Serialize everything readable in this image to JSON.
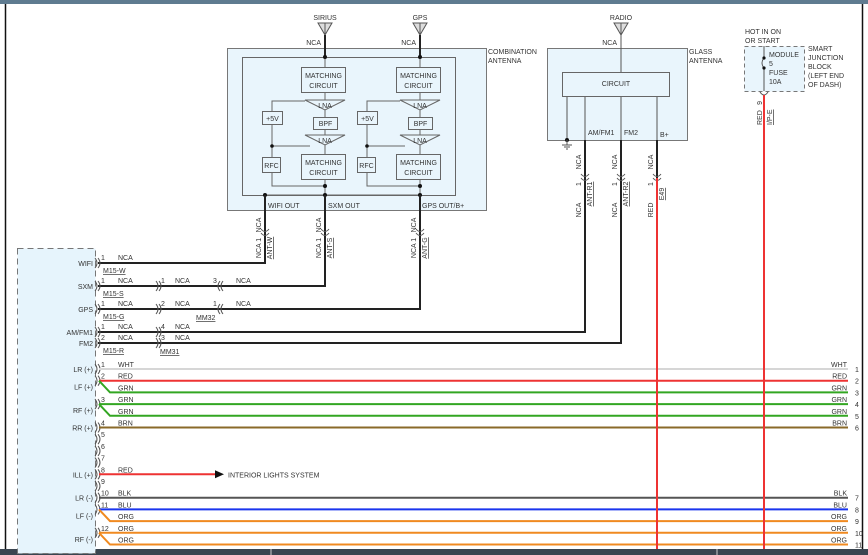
{
  "colors": {
    "WHT": "#d6d6d6",
    "RED": "#ee3333",
    "GRN": "#33a622",
    "BRN": "#8a6a2a",
    "BLK": "#555555",
    "BLU": "#1a35ee",
    "ORG": "#f08a20",
    "NCA": "#222222"
  },
  "combination_antenna": {
    "title_line1": "COMBINATION",
    "title_line2": "ANTENNA",
    "sirius": "SIRIUS",
    "gps": "GPS",
    "nca": "NCA",
    "matching_line1": "MATCHING",
    "matching_line2": "CIRCUIT",
    "lna": "LNA",
    "bpf": "BPF",
    "plus5v": "+5V",
    "rfc": "RFC",
    "wifi_out": "WIFI OUT",
    "sxm_out": "SXM OUT",
    "gps_out": "GPS OUT/B+",
    "connectors": [
      {
        "wire": "NCA",
        "pin": "NCA 1",
        "connector": "ANT-W"
      },
      {
        "wire": "NCA",
        "pin": "NCA 1",
        "connector": "ANT-S"
      },
      {
        "wire": "NCA",
        "pin": "NCA 1",
        "connector": "ANT-G"
      }
    ]
  },
  "glass_antenna": {
    "title_line1": "GLASS",
    "title_line2": "ANTENNA",
    "radio": "RADIO",
    "nca": "NCA",
    "circuit": "CIRCUIT",
    "outputs": [
      {
        "label": "AM/FM1",
        "wire_top": "NCA",
        "pin": "1",
        "connector": "ANT-R1",
        "wire_bottom": "NCA"
      },
      {
        "label": "FM2",
        "wire_top": "NCA",
        "pin": "1",
        "connector": "ANT-R2",
        "wire_bottom": "NCA"
      },
      {
        "label": "B+",
        "wire_top": "NCA",
        "pin": "1",
        "connector": "E49",
        "wire_bottom": "RED"
      }
    ]
  },
  "junction_block": {
    "hot_line1": "HOT IN ON",
    "hot_line2": "OR START",
    "fuse_line1": "MODULE",
    "fuse_line2": "5",
    "fuse_line3": "FUSE",
    "fuse_line4": "10A",
    "name_line1": "SMART",
    "name_line2": "JUNCTION",
    "name_line3": "BLOCK",
    "name_line4": "(LEFT END",
    "name_line5": "OF DASH)",
    "pin": "9",
    "wire": "RED",
    "connector": "I/P-E"
  },
  "radio_antenna_rows": [
    {
      "circuit": "WIFI",
      "pin": "1",
      "wire": "NCA",
      "connector": "M15-W"
    },
    {
      "circuit": "SXM",
      "pin": "1",
      "wire": "NCA",
      "connector": "M15-S",
      "inline_pin": "1",
      "inline_wire": "NCA",
      "inline_pin2": "3",
      "inline_wire2": "NCA"
    },
    {
      "circuit": "GPS",
      "pin": "1",
      "wire": "NCA",
      "connector": "M15-G",
      "inline_pin": "2",
      "inline_wire": "NCA",
      "inline_pin2": "1",
      "inline_wire2": "NCA",
      "inline_connector": "MM32"
    },
    {
      "circuit": "AM/FM1",
      "pin": "1",
      "wire": "NCA",
      "inline_pin": "4",
      "inline_wire": "NCA"
    },
    {
      "circuit": "FM2",
      "pin": "2",
      "wire": "NCA",
      "connector": "M15-R",
      "inline_pin": "3",
      "inline_wire": "NCA",
      "inline_connector": "MM31"
    }
  ],
  "speaker_rows": [
    {
      "circuit": "LR (+)",
      "pin": "1",
      "wire": "WHT",
      "right_pin": "1"
    },
    {
      "circuit": "LF (+)",
      "pin": "2",
      "wire": "RED",
      "right_pin": "2"
    },
    {
      "circuit": "",
      "pin": "",
      "wire": "GRN",
      "right_pin": "3"
    },
    {
      "circuit": "RF (+)",
      "pin": "3",
      "wire": "GRN",
      "right_pin": "4"
    },
    {
      "circuit": "",
      "pin": "",
      "wire": "GRN",
      "right_pin": "5"
    },
    {
      "circuit": "RR (+)",
      "pin": "4",
      "wire": "BRN",
      "right_pin": "6"
    },
    {
      "circuit": "",
      "pin": "5",
      "wire": "",
      "right_pin": ""
    },
    {
      "circuit": "",
      "pin": "6",
      "wire": "",
      "right_pin": ""
    },
    {
      "circuit": "",
      "pin": "7",
      "wire": "",
      "right_pin": ""
    },
    {
      "circuit": "ILL (+)",
      "pin": "8",
      "wire": "RED",
      "right_pin": "",
      "destination": "INTERIOR LIGHTS SYSTEM"
    },
    {
      "circuit": "",
      "pin": "9",
      "wire": "",
      "right_pin": ""
    },
    {
      "circuit": "LR (-)",
      "pin": "10",
      "wire": "BLK",
      "right_pin": "7"
    },
    {
      "circuit": "LF (-)",
      "pin": "11",
      "wire": "BLU",
      "right_pin": "8"
    },
    {
      "circuit": "",
      "pin": "",
      "wire": "ORG",
      "right_pin": "9"
    },
    {
      "circuit": "RF (-)",
      "pin": "12",
      "wire": "ORG",
      "right_pin": "10"
    },
    {
      "circuit": "",
      "pin": "",
      "wire": "ORG",
      "right_pin": "11"
    }
  ]
}
